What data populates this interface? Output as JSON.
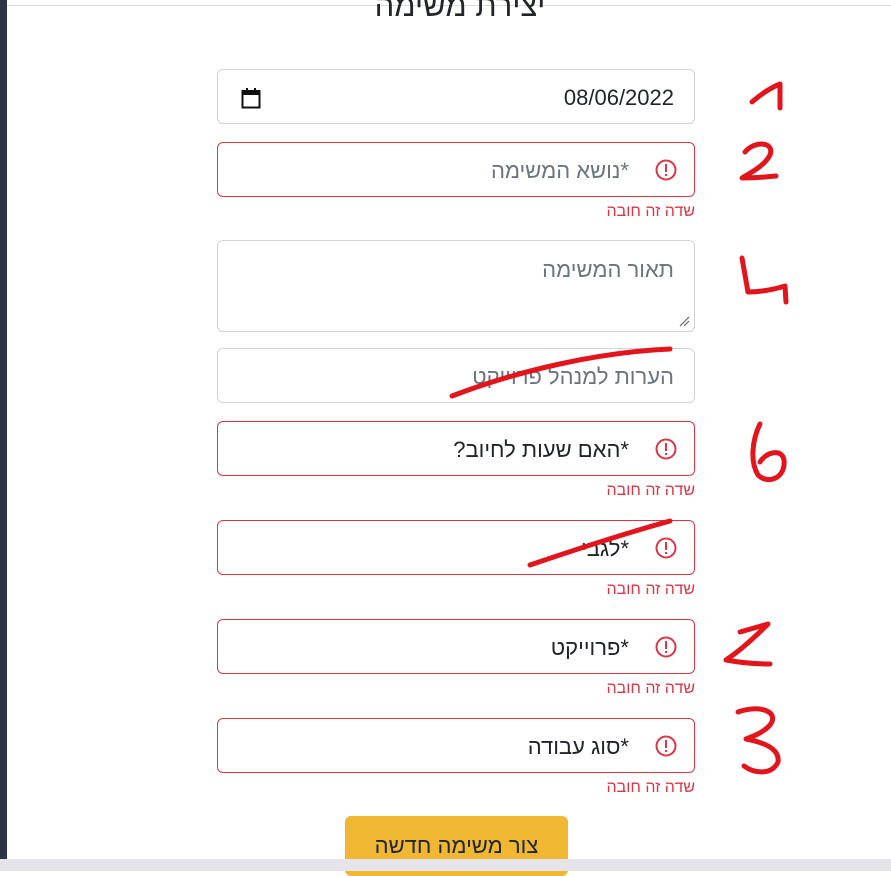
{
  "form": {
    "title": "יצירת משימה",
    "date_value": "08/06/2022",
    "subject_placeholder": "*נושא המשימה",
    "description_placeholder": "תאור המשימה",
    "pm_notes_placeholder": "הערות למנהל פרוייקט",
    "billable_placeholder": "*האם שעות לחיוב?",
    "regarding_placeholder": "*לגבי",
    "project_placeholder": "*פרוייקט",
    "work_type_placeholder": "*סוג עבודה",
    "required_error": "שדה זה חובה",
    "submit_label": "צור משימה חדשה"
  },
  "colors": {
    "invalid": "#dc3545",
    "submit_bg": "#f0b733",
    "annotation": "#e2151c"
  },
  "icons": {
    "date": "calendar-icon",
    "error": "exclamation-circle-icon"
  }
}
